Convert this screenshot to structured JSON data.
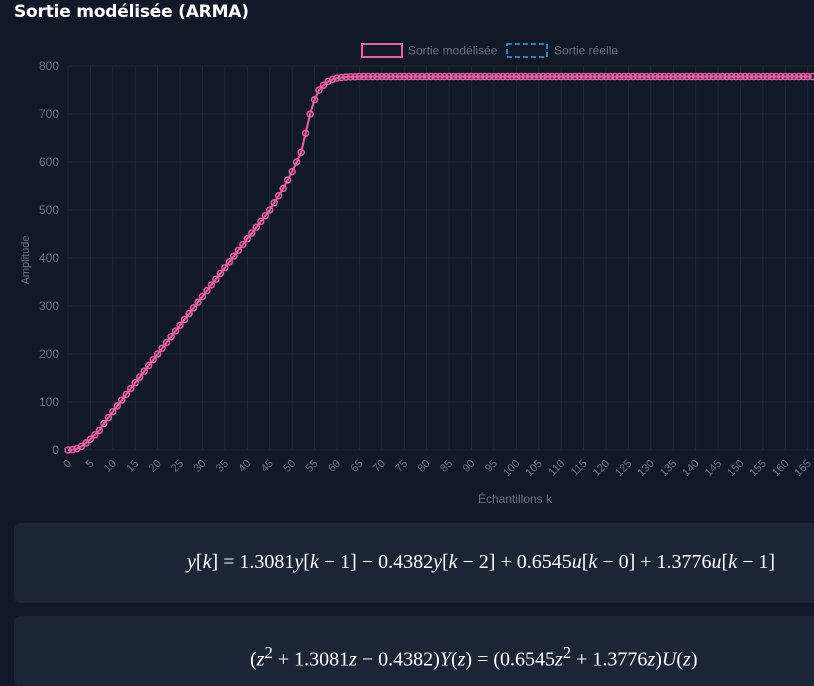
{
  "title": "Sortie modélisée (ARMA)",
  "legend": {
    "modeled": "Sortie modélisée",
    "real": "Sortie réelle"
  },
  "colors": {
    "background": "#111827",
    "grid": "#1f2937",
    "modeled": "#ec5fa5",
    "real": "#38a0da",
    "axis_text": "#6b7280",
    "card": "#1c2536"
  },
  "chart_data": {
    "type": "line",
    "title": "",
    "xlabel": "Échantillons k",
    "ylabel": "Amplitude",
    "ylim": [
      0,
      800
    ],
    "yticks": [
      0,
      100,
      200,
      300,
      400,
      500,
      600,
      700,
      800
    ],
    "xticks": [
      0,
      5,
      10,
      15,
      20,
      25,
      30,
      35,
      40,
      45,
      50,
      55,
      60,
      65,
      70,
      75,
      80,
      85,
      90,
      95,
      100,
      105,
      110,
      115,
      120,
      125,
      130,
      135,
      140,
      145,
      150,
      155,
      160,
      165
    ],
    "legend_position": "top-center",
    "grid": true,
    "series": [
      {
        "name": "Sortie modélisée",
        "style": "line-with-circle-markers",
        "x_range": [
          0,
          166
        ],
        "knots": [
          [
            0,
            0
          ],
          [
            1,
            0.65
          ],
          [
            2,
            2.9
          ],
          [
            3,
            7.6
          ],
          [
            4,
            14.5
          ],
          [
            5,
            22.5
          ],
          [
            6,
            31.5
          ],
          [
            7,
            41
          ],
          [
            8,
            55
          ],
          [
            10,
            80
          ],
          [
            12,
            104
          ],
          [
            15,
            140
          ],
          [
            20,
            200
          ],
          [
            30,
            320
          ],
          [
            40,
            440
          ],
          [
            45,
            500
          ],
          [
            48,
            545
          ],
          [
            50,
            580
          ],
          [
            52,
            620
          ],
          [
            54,
            700
          ],
          [
            55,
            730
          ],
          [
            56,
            750
          ],
          [
            57,
            760
          ],
          [
            58,
            768
          ],
          [
            59,
            772
          ],
          [
            60,
            775
          ],
          [
            62,
            777
          ],
          [
            65,
            778
          ],
          [
            166,
            778
          ]
        ]
      },
      {
        "name": "Sortie réelle",
        "style": "dashed-line",
        "x_range": [
          0,
          166
        ],
        "knots": []
      }
    ]
  },
  "equations": {
    "difference": "y[k] = 1.3081y[k − 1] − 0.4382y[k − 2] + 0.6545u[k − 0] + 1.3776u[k − 1]",
    "transfer": "(z² + 1.3081z − 0.4382)Y(z) = (0.6545z² + 1.3776z)U(z)"
  }
}
